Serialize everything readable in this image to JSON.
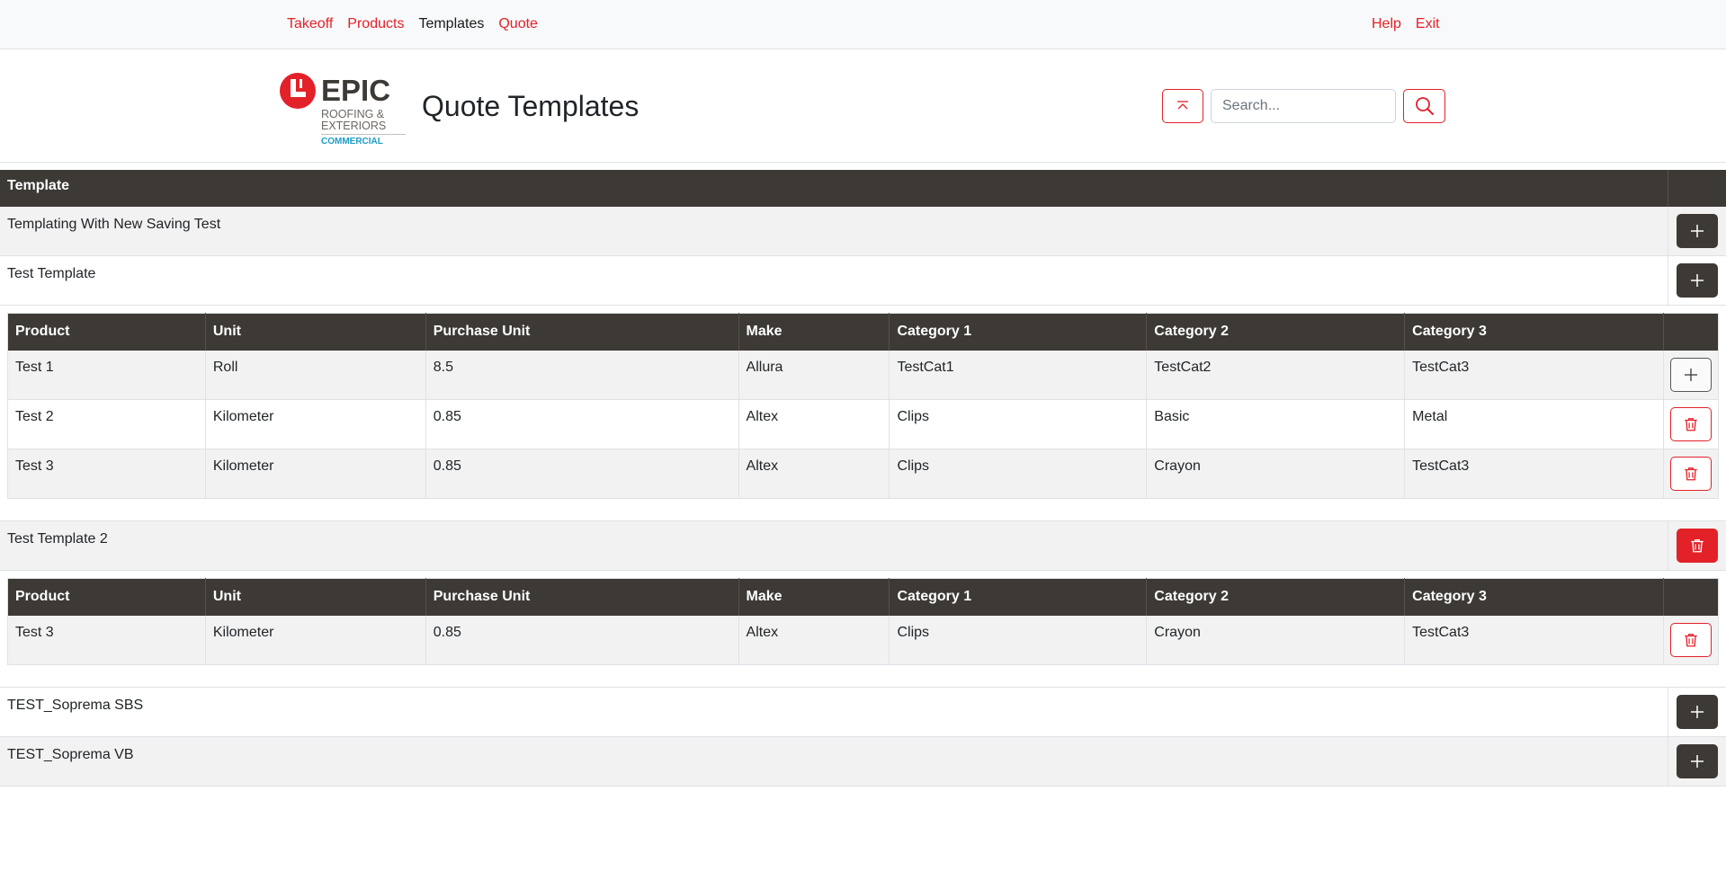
{
  "nav": {
    "left": [
      {
        "label": "Takeoff"
      },
      {
        "label": "Products"
      },
      {
        "label": "Templates"
      },
      {
        "label": "Quote"
      }
    ],
    "right": [
      {
        "label": "Help"
      },
      {
        "label": "Exit"
      }
    ],
    "active": "Templates"
  },
  "logo": {
    "brand": "EPIC",
    "line1": "ROOFING &",
    "line2": "EXTERIORS",
    "line3": "COMMERCIAL"
  },
  "header": {
    "title": "Quote Templates",
    "search_placeholder": "Search..."
  },
  "icons": {
    "scroll_top": "chevron-bar-up-icon",
    "search": "search-icon",
    "add": "plus-icon",
    "delete": "trash-icon"
  },
  "colors": {
    "accent": "#e32129",
    "header_dark": "#3d3935",
    "row_alt": "#f2f2f2"
  },
  "table": {
    "header": "Template",
    "sub_columns": [
      "Product",
      "Unit",
      "Purchase Unit",
      "Make",
      "Category 1",
      "Category 2",
      "Category 3"
    ],
    "templates": [
      {
        "name": "Templating With New Saving Test"
      },
      {
        "name": "Test Template"
      },
      {
        "name": "Test Template 2"
      },
      {
        "name": "TEST_Soprema SBS"
      },
      {
        "name": "TEST_Soprema VB"
      }
    ],
    "test_template_products": [
      {
        "product": "Test 1",
        "unit": "Roll",
        "purchase_unit": "8.5",
        "make": "Allura",
        "cat1": "TestCat1",
        "cat2": "TestCat2",
        "cat3": "TestCat3"
      },
      {
        "product": "Test 2",
        "unit": "Kilometer",
        "purchase_unit": "0.85",
        "make": "Altex",
        "cat1": "Clips",
        "cat2": "Basic",
        "cat3": "Metal"
      },
      {
        "product": "Test 3",
        "unit": "Kilometer",
        "purchase_unit": "0.85",
        "make": "Altex",
        "cat1": "Clips",
        "cat2": "Crayon",
        "cat3": "TestCat3"
      }
    ],
    "test_template_2_products": [
      {
        "product": "Test 3",
        "unit": "Kilometer",
        "purchase_unit": "0.85",
        "make": "Altex",
        "cat1": "Clips",
        "cat2": "Crayon",
        "cat3": "TestCat3"
      }
    ]
  }
}
